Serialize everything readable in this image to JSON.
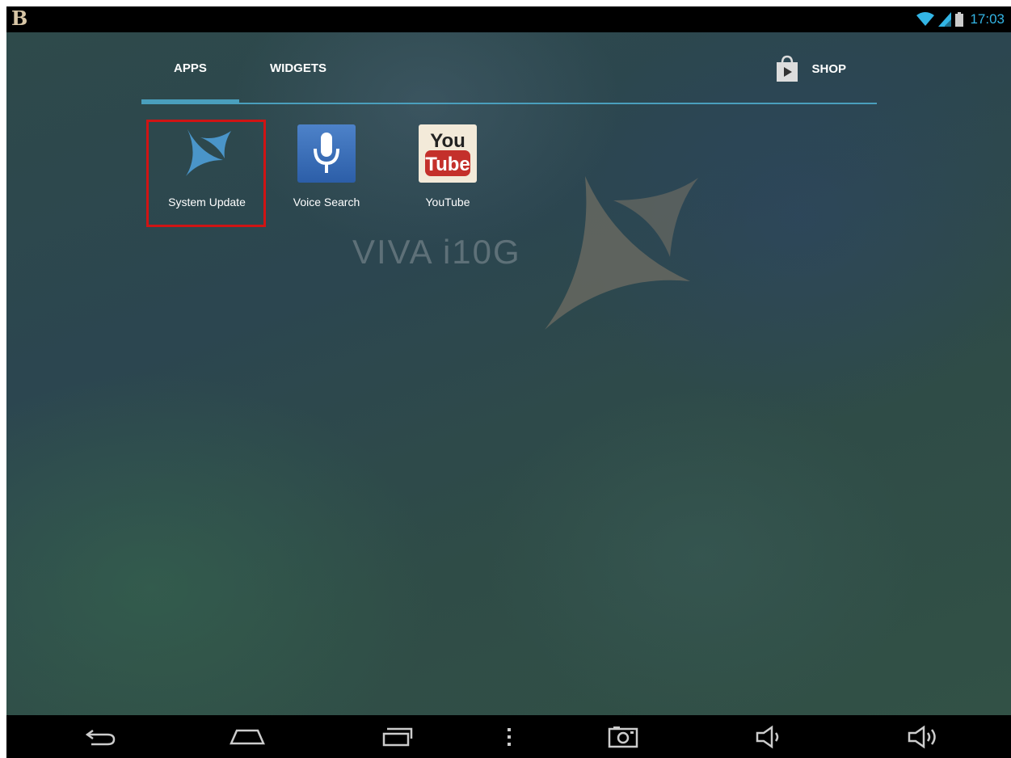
{
  "status_bar": {
    "time": "17:03",
    "icons": [
      "b-logo-icon",
      "wifi-icon",
      "signal-icon",
      "battery-icon"
    ],
    "time_color": "#33b5e5"
  },
  "tabs": [
    {
      "label": "APPS",
      "selected": true
    },
    {
      "label": "WIDGETS",
      "selected": false
    }
  ],
  "shop": {
    "label": "SHOP",
    "icon": "play-store-bag-icon"
  },
  "apps": [
    {
      "label": "System Update",
      "icon": "system-update-icon",
      "highlighted": true
    },
    {
      "label": "Voice Search",
      "icon": "microphone-icon"
    },
    {
      "label": "YouTube",
      "icon": "youtube-icon",
      "icon_text_top": "You",
      "icon_text_bottom": "Tube"
    }
  ],
  "wallpaper": {
    "brand_text": "VIVA i10G"
  },
  "nav_bar": {
    "buttons": [
      "back-icon",
      "home-icon",
      "recent-apps-icon",
      "menu-icon",
      "screenshot-icon",
      "volume-down-icon",
      "volume-up-icon"
    ]
  },
  "colors": {
    "accent": "#4a9fbd",
    "highlight_border": "#d01414",
    "status_bar_bg": "#000000"
  }
}
